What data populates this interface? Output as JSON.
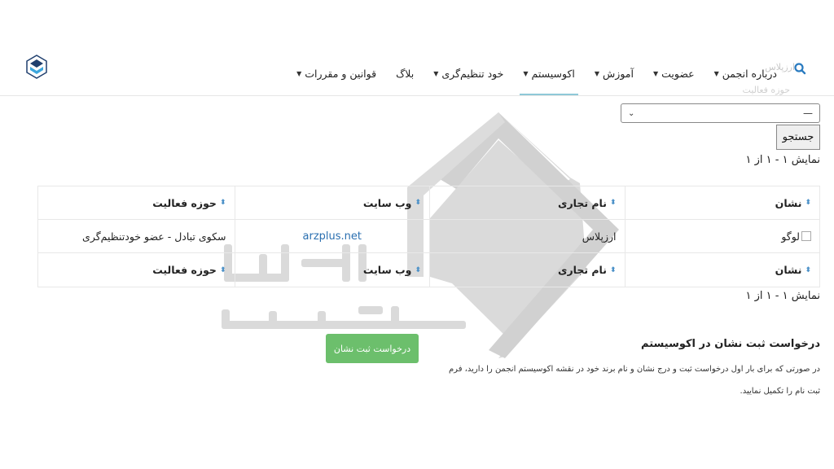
{
  "nav": {
    "items": [
      {
        "label": "درباره انجمن",
        "caret": true
      },
      {
        "label": "عضویت",
        "caret": true
      },
      {
        "label": "آموزش",
        "caret": true
      },
      {
        "label": "اکوسیستم",
        "caret": true,
        "active": true
      },
      {
        "label": "خود تنظیم‌گری",
        "caret": true
      },
      {
        "label": "بلاگ",
        "caret": false
      },
      {
        "label": "قوانین و مقررات",
        "caret": true
      }
    ],
    "search_placeholder": "ارزپلاس",
    "ghost_label": "حوزه فعالیت"
  },
  "filter": {
    "select_value": "—",
    "search_button": "جستجو"
  },
  "result_count": "نمایش ۱ - ۱ از ۱",
  "table": {
    "headers": [
      "نشان",
      "نام تجاری",
      "وب سایت",
      "حوزه فعالیت"
    ],
    "rows": [
      {
        "logo_alt": "لوگو",
        "brand": "ارزپلاس",
        "website": "arzplus.net",
        "activity": "سکوی تبادل - عضو خودتنظیم‌گری"
      }
    ]
  },
  "request": {
    "title": "درخواست ثبت نشان در اکوسیستم",
    "text": "در صورتی که برای بار اول درخواست ثبت و درج نشان و نام برند خود در نقشه اکوسیستم انجمن را دارید، فرم ثبت نام را تکمیل نمایید.",
    "button": "درخواست ثبت نشان"
  },
  "colors": {
    "accent": "#8fc9d8",
    "button_green": "#6cbf6c",
    "link": "#2a6fb0",
    "sort_icon": "#4a90c8"
  }
}
